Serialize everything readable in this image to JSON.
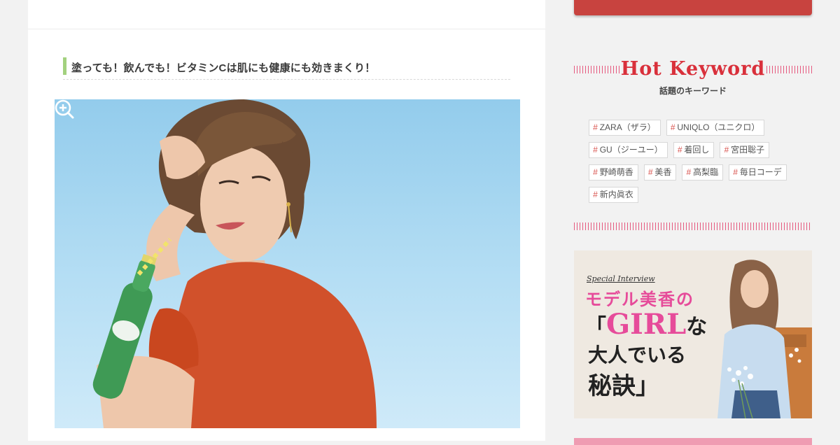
{
  "article": {
    "heading": "塗っても！飲んでも！ビタミンCは肌にも健康にも効きまくり！",
    "image_alt": "オレンジのトップスを着た女性がペリエのボトルを持っている写真"
  },
  "sidebar": {
    "hot_keyword": {
      "title": "Hot Keyword",
      "subtitle": "話題のキーワード",
      "hash_symbol": "#",
      "items": [
        {
          "label": "ZARA（ザラ）"
        },
        {
          "label": "UNIQLO（ユニクロ）"
        },
        {
          "label": "GU（ジーユー）"
        },
        {
          "label": "着回し"
        },
        {
          "label": "宮田聡子"
        },
        {
          "label": "野崎萌香"
        },
        {
          "label": "美香"
        },
        {
          "label": "高梨臨"
        },
        {
          "label": "毎日コーデ"
        },
        {
          "label": "新内眞衣"
        }
      ]
    },
    "promo": {
      "kicker": "Special Interview",
      "line1": "モデル美香の",
      "line2_open": "「",
      "line2_main": "GIRL",
      "line2_suffix": "な",
      "line3": "大人でいる",
      "line4": "秘訣」"
    }
  },
  "colors": {
    "accent_red": "#c8433f",
    "keyword_title": "#d9303b",
    "promo_pink": "#e64b9a",
    "heading_bar": "#a3d17f"
  },
  "icons": {
    "zoom": "zoom-in-icon"
  }
}
